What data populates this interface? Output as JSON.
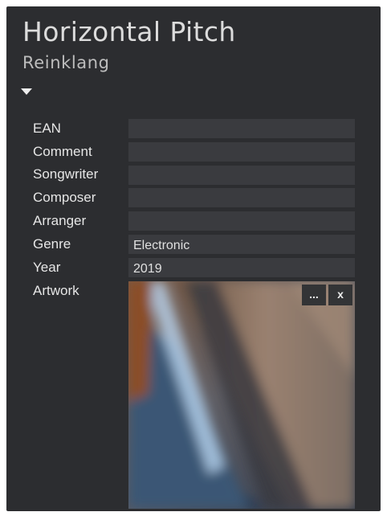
{
  "header": {
    "title": "Horizontal Pitch",
    "artist": "Reinklang"
  },
  "icons": {
    "disclosure": "triangle-down-icon"
  },
  "fields": [
    {
      "label": "EAN",
      "value": ""
    },
    {
      "label": "Comment",
      "value": ""
    },
    {
      "label": "Songwriter",
      "value": ""
    },
    {
      "label": "Composer",
      "value": ""
    },
    {
      "label": "Arranger",
      "value": ""
    },
    {
      "label": "Genre",
      "value": "Electronic"
    },
    {
      "label": "Year",
      "value": "2019"
    }
  ],
  "artwork": {
    "label": "Artwork",
    "browse_label": "...",
    "remove_label": "x"
  },
  "colors": {
    "panel_bg": "#2c2d30",
    "field_bg": "#3a3b3f",
    "text": "#e6e6e6"
  }
}
